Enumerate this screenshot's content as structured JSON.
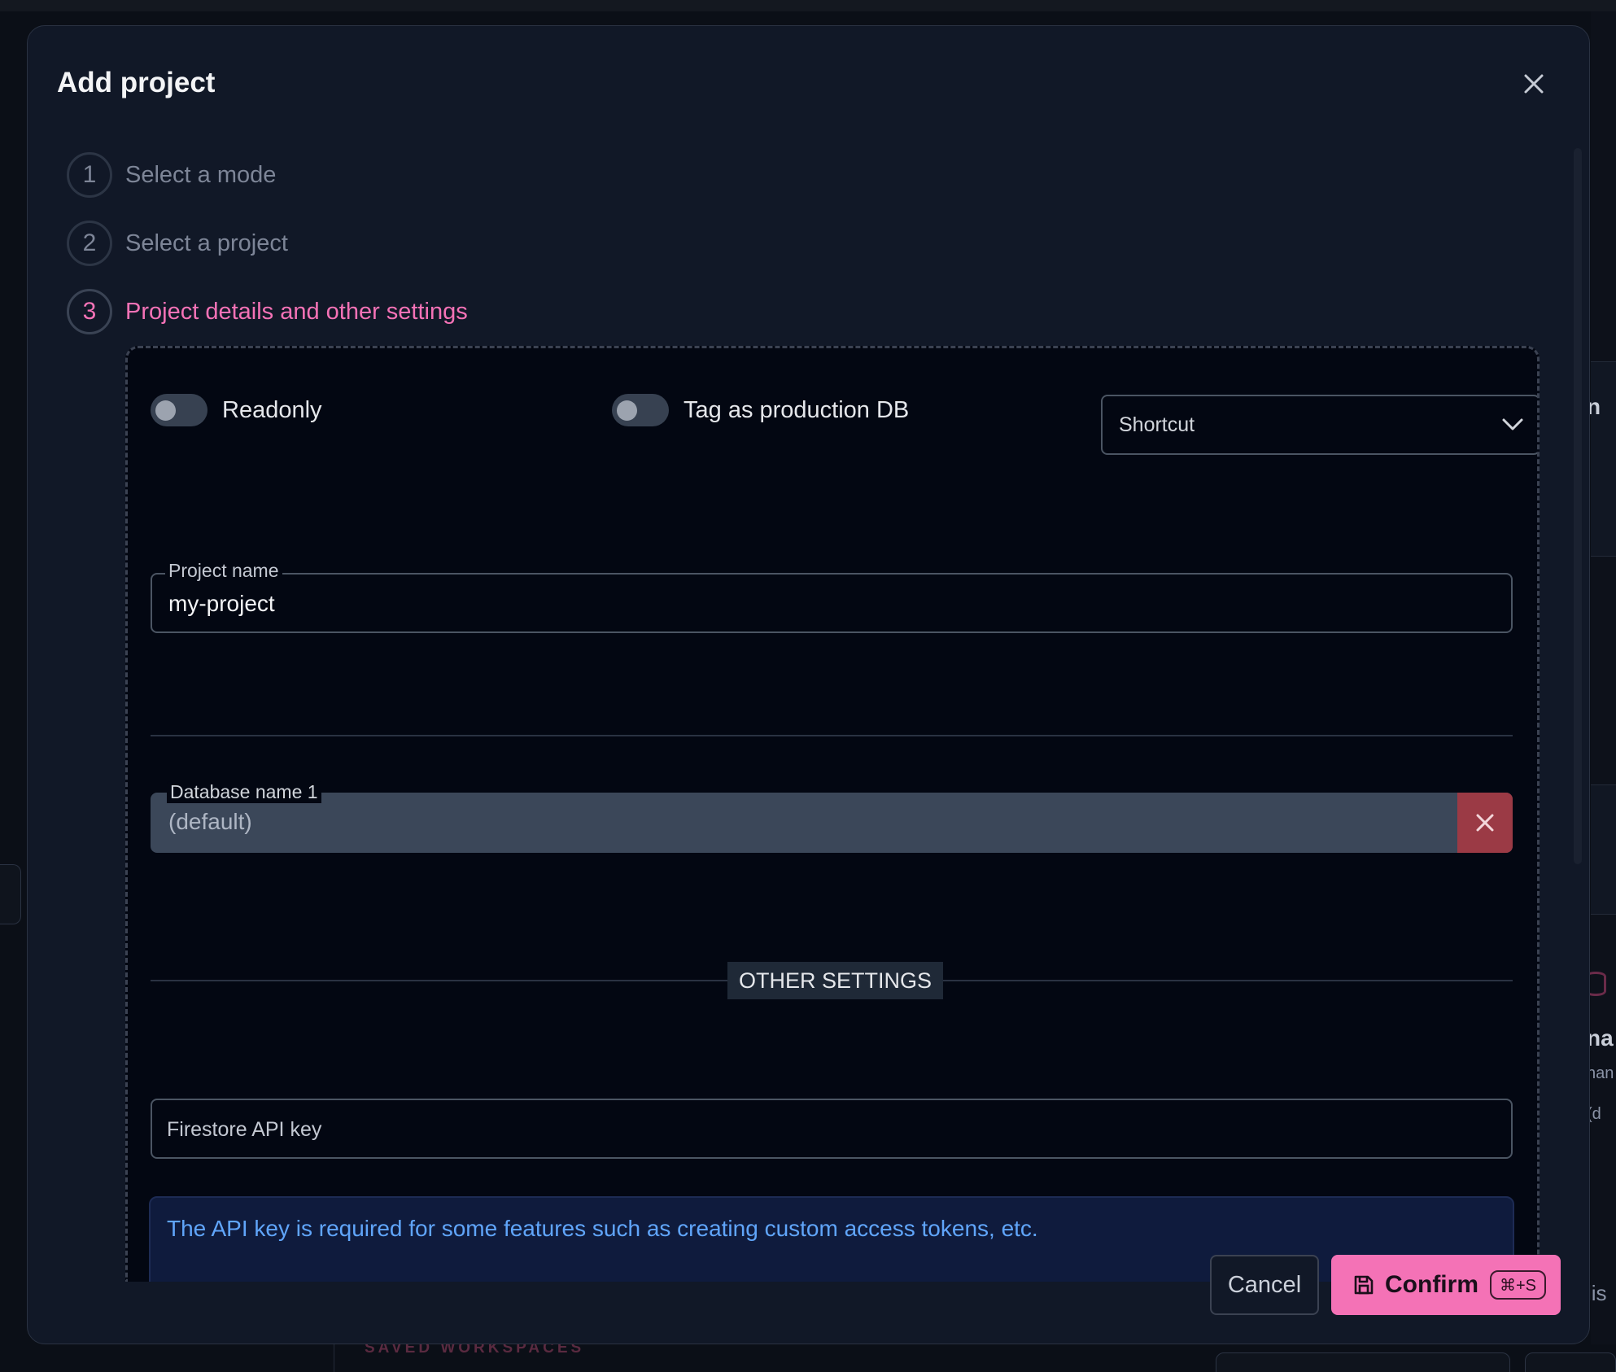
{
  "modal": {
    "title": "Add project",
    "steps": [
      {
        "number": "1",
        "label": "Select a mode"
      },
      {
        "number": "2",
        "label": "Select a project"
      },
      {
        "number": "3",
        "label": "Project details and other settings"
      }
    ],
    "active_step": 3
  },
  "settings": {
    "readonly_label": "Readonly",
    "readonly_on": false,
    "production_label": "Tag as production DB",
    "production_on": false,
    "shortcut_select": {
      "value": "Shortcut"
    }
  },
  "project_name": {
    "legend": "Project name",
    "value": "my-project"
  },
  "database": {
    "legend": "Database name 1",
    "value": "(default)"
  },
  "other_settings": {
    "heading": "OTHER SETTINGS",
    "api_key_placeholder": "Firestore API key",
    "info": "The API key is required for some features such as creating custom access tokens, etc."
  },
  "footer": {
    "cancel_label": "Cancel",
    "confirm_label": "Confirm",
    "confirm_shortcut": "⌘+S"
  },
  "background": {
    "saved_workspaces": "SAVED WORKSPACES",
    "partial_text_1": "n",
    "partial_text_2": "na",
    "partial_text_3": "han",
    "partial_text_4": "(d",
    "partial_text_5": "lis"
  },
  "colors": {
    "accent": "#f472b6",
    "modal_bg": "#111827",
    "panel_bg": "#030712",
    "danger": "#9b3a45",
    "info_text": "#60a5fa"
  }
}
